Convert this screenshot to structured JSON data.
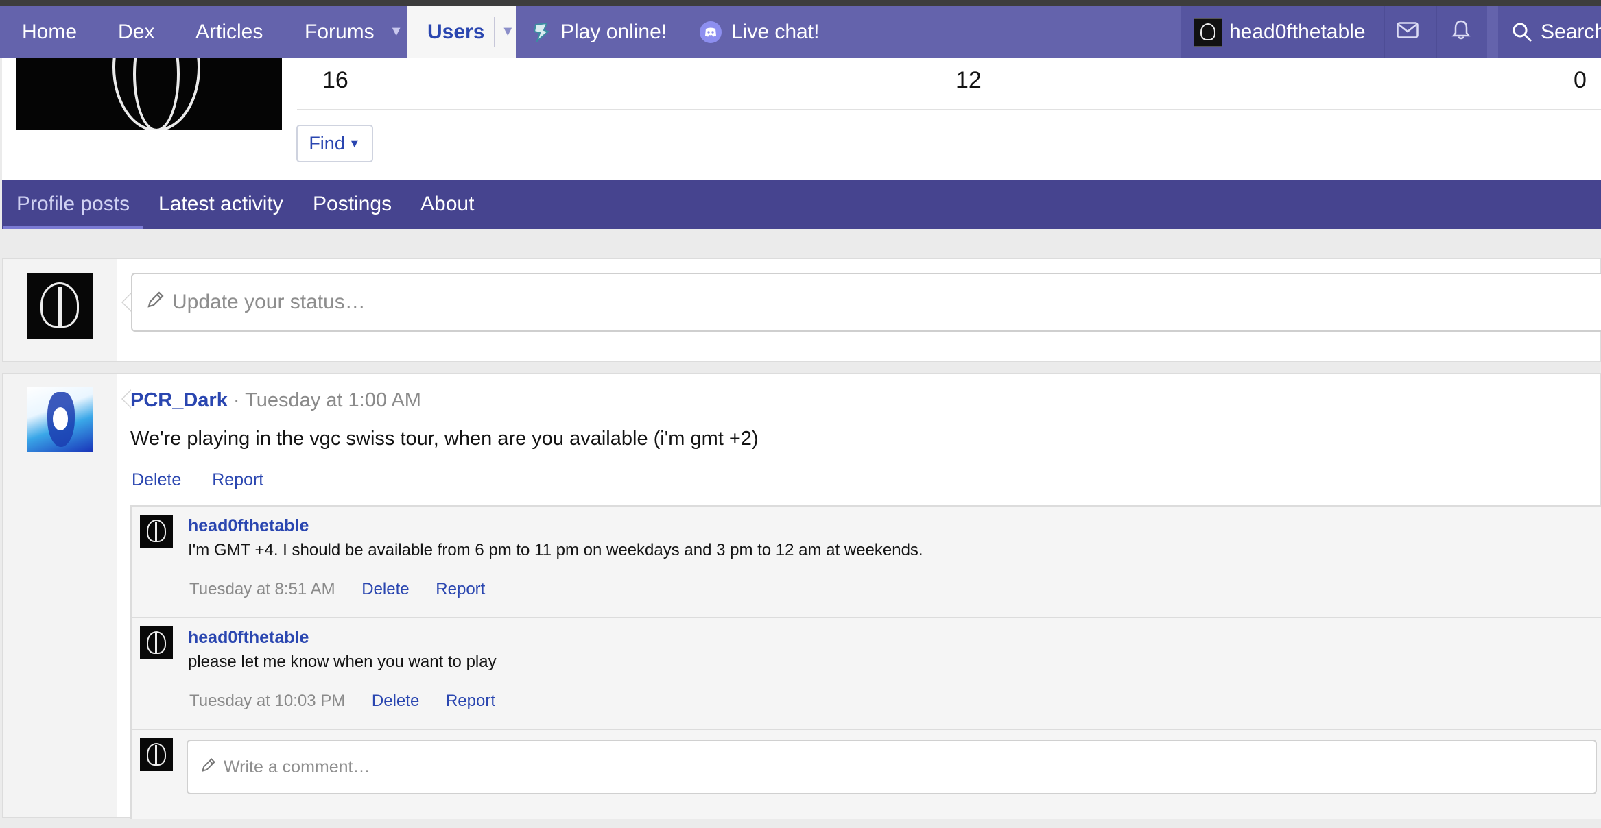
{
  "nav": {
    "home": "Home",
    "dex": "Dex",
    "articles": "Articles",
    "forums": "Forums",
    "users": "Users",
    "play_online": "Play online!",
    "live_chat": "Live chat!",
    "username": "head0fthetable",
    "search": "Search"
  },
  "profile": {
    "stats": [
      "16",
      "12",
      "0"
    ],
    "find_label": "Find"
  },
  "tabs": [
    "Profile posts",
    "Latest activity",
    "Postings",
    "About"
  ],
  "status": {
    "placeholder": "Update your status…"
  },
  "post": {
    "author": "PCR_Dark",
    "time": "· Tuesday at 1:00 AM",
    "body": "We're playing in the vgc swiss tour, when are you available (i'm gmt +2)",
    "delete": "Delete",
    "report": "Report",
    "comments": [
      {
        "author": "head0fthetable",
        "text": "I'm GMT +4. I should be available from 6 pm to 11 pm on weekdays and 3 pm to 12 am at weekends.",
        "time": "Tuesday at 8:51 AM",
        "delete": "Delete",
        "report": "Report"
      },
      {
        "author": "head0fthetable",
        "text": "please let me know when you want to play",
        "time": "Tuesday at 10:03 PM",
        "delete": "Delete",
        "report": "Report"
      }
    ],
    "comment_placeholder": "Write a comment…"
  },
  "colors": {
    "nav_bg": "#6463ac",
    "tab_bg": "#46448f",
    "link": "#2a46b0"
  }
}
